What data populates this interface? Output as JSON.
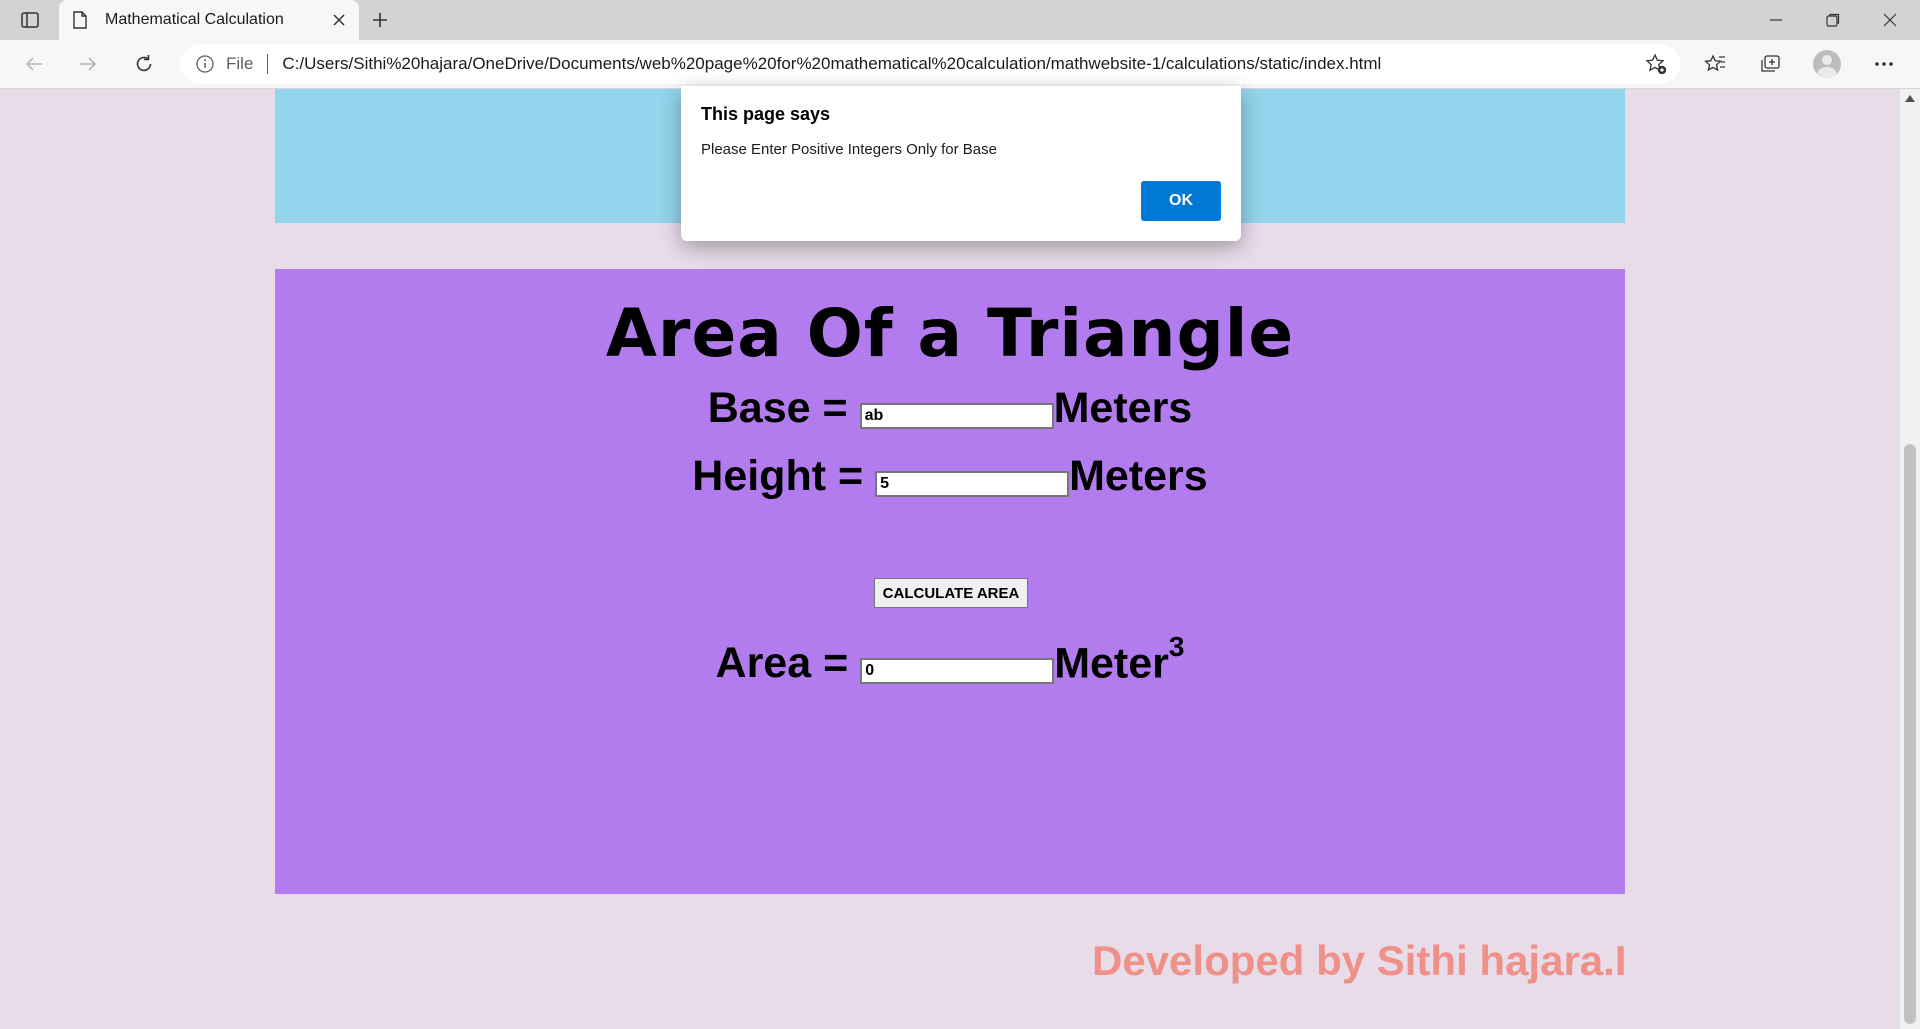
{
  "browser": {
    "tab_title": "Mathematical Calculation",
    "address_scheme": "File",
    "url": "C:/Users/Sithi%20hajara/OneDrive/Documents/web%20page%20for%20mathematical%20calculation/mathwebsite-1/calculations/static/index.html"
  },
  "page": {
    "heading": "Area Of a Triangle",
    "base": {
      "label": "Base =",
      "value": "ab",
      "unit": "Meters"
    },
    "height": {
      "label": "Height =",
      "value": "5",
      "unit": "Meters"
    },
    "calculate_button": "CALCULATE AREA",
    "area": {
      "label": "Area =",
      "value": "0",
      "unit": "Meter",
      "unit_power": "3"
    },
    "credit": "Developed by Sithi hajara.I"
  },
  "dialog": {
    "title": "This page says",
    "message": "Please Enter Positive Integers Only for Base",
    "ok_label": "OK"
  },
  "colors": {
    "top_panel": "#93d5ec",
    "main_panel": "#b27cee",
    "page_background": "#e8dce9",
    "credit_text": "#ef9089",
    "dialog_button": "#0078d4"
  }
}
